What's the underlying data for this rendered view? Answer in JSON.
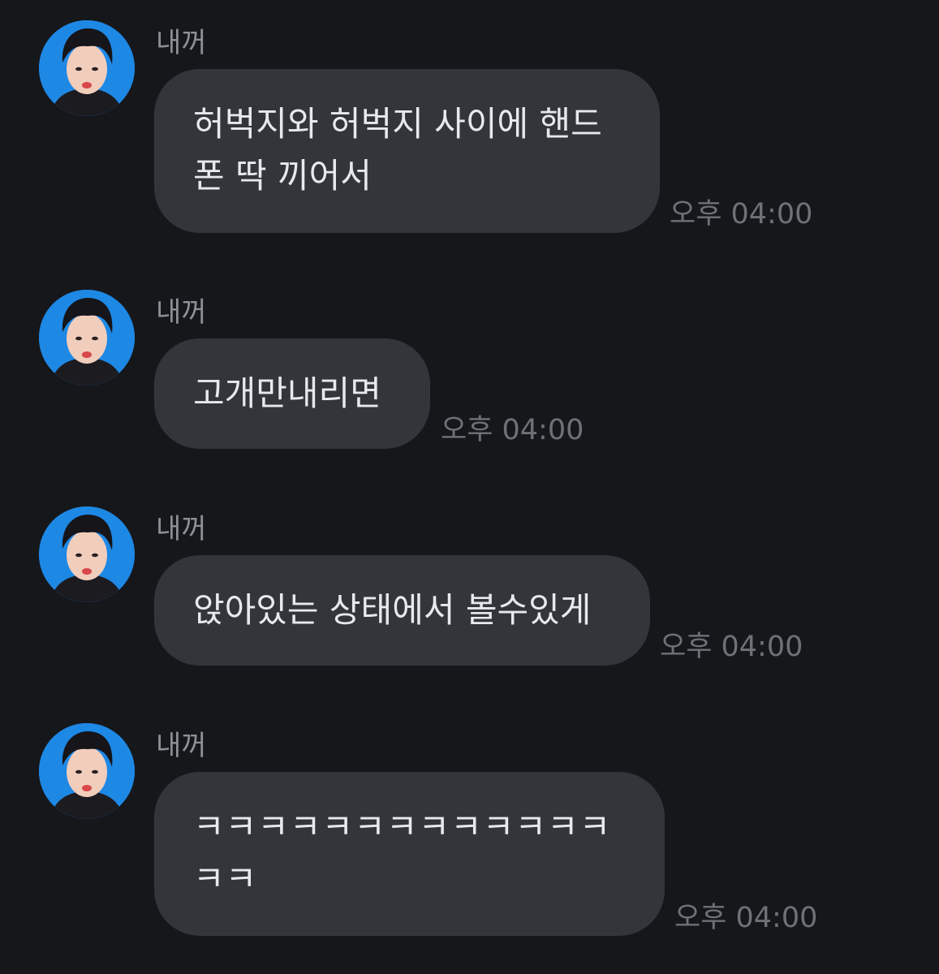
{
  "colors": {
    "background": "#16171b",
    "bubble": "#33353b",
    "bubble_text": "#e8e9ec",
    "sender_text": "#8e9096",
    "time_text": "#6f7177",
    "avatar_bg": "#1e88e5"
  },
  "messages": [
    {
      "sender": "내꺼",
      "text": "허벅지와 허벅지 사이에 핸드\n폰 딱 끼어서",
      "time": "오후 04:00"
    },
    {
      "sender": "내꺼",
      "text": "고개만내리면",
      "time": "오후 04:00"
    },
    {
      "sender": "내꺼",
      "text": "앉아있는 상태에서 볼수있게",
      "time": "오후 04:00"
    },
    {
      "sender": "내꺼",
      "text": "ㅋㅋㅋㅋㅋㅋㅋㅋㅋㅋㅋㅋㅋ\nㅋㅋ",
      "time": "오후 04:00"
    }
  ]
}
